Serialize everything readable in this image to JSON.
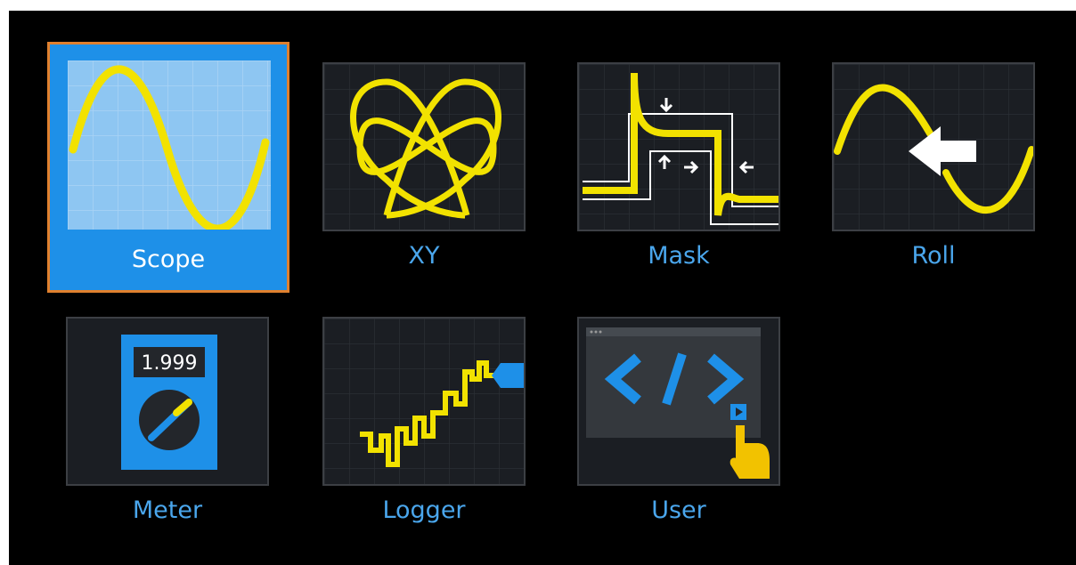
{
  "modes": [
    {
      "id": "scope",
      "label": "Scope",
      "icon": "sine-wave-icon",
      "selected": true
    },
    {
      "id": "xy",
      "label": "XY",
      "icon": "lissajous-icon",
      "selected": false
    },
    {
      "id": "mask",
      "label": "Mask",
      "icon": "mask-test-icon",
      "selected": false
    },
    {
      "id": "roll",
      "label": "Roll",
      "icon": "roll-arrow-icon",
      "selected": false
    },
    {
      "id": "meter",
      "label": "Meter",
      "icon": "multimeter-icon",
      "selected": false,
      "display_value": "1.999"
    },
    {
      "id": "logger",
      "label": "Logger",
      "icon": "logger-icon",
      "selected": false
    },
    {
      "id": "user",
      "label": "User",
      "icon": "code-tag-icon",
      "selected": false
    }
  ],
  "colors": {
    "background": "#000000",
    "tile_background": "#1b1e23",
    "label_text": "#4aa6ec",
    "selected_background": "#1e90e8",
    "selected_outline": "#e0802e",
    "trace": "#f2e200"
  }
}
